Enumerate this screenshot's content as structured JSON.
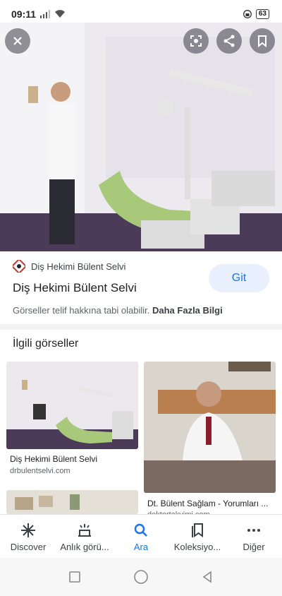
{
  "status": {
    "time": "09:11",
    "battery": "63"
  },
  "hero": {
    "close_label": "close",
    "lens_label": "lens",
    "share_label": "share",
    "save_label": "save"
  },
  "result": {
    "source": "Diş Hekimi Bülent Selvi",
    "title": "Diş Hekimi Bülent Selvi",
    "visit_label": "Git",
    "copyright_text": "Görseller telif hakkına tabi olabilir.",
    "more_info": "Daha Fazla Bilgi"
  },
  "related": {
    "heading": "İlgili görseller",
    "items": [
      {
        "caption": "Diş Hekimi Bülent Selvi",
        "source": "drbulentselvi.com"
      },
      {
        "caption": "Dt. Bülent Sağlam - Yorumları ...",
        "source": "doktortakvimi.com"
      }
    ]
  },
  "nav": {
    "items": [
      {
        "label": "Discover",
        "icon": "asterisk-icon"
      },
      {
        "label": "Anlık görü...",
        "icon": "updates-icon"
      },
      {
        "label": "Ara",
        "icon": "search-icon"
      },
      {
        "label": "Koleksiyo...",
        "icon": "collections-icon"
      },
      {
        "label": "Diğer",
        "icon": "more-icon"
      }
    ],
    "active": "Ara"
  },
  "colors": {
    "accent": "#1a73e8",
    "chip_bg": "#e8f0fe"
  }
}
